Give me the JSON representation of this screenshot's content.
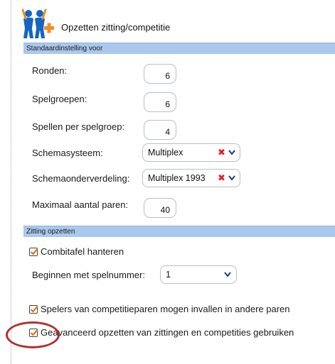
{
  "header": {
    "title": "Opzetten zitting/competitie",
    "logo_icon": "players-plus-logo"
  },
  "section_default": {
    "title": "Standaardinstelling voor",
    "rounds": {
      "label": "Ronden:",
      "value": "6"
    },
    "groups": {
      "label": "Spelgroepen:",
      "value": "6"
    },
    "games_per_group": {
      "label": "Spellen per spelgroep:",
      "value": "4"
    },
    "schema_system": {
      "label": "Schemasysteem:",
      "value": "Multiplex"
    },
    "schema_subdivision": {
      "label": "Schemaonderverdeling:",
      "value": "Multiplex 1993"
    },
    "max_pairs": {
      "label": "Maximaal aantal paren:",
      "value": "40"
    }
  },
  "section_session": {
    "title": "Zitting opzetten",
    "combitable": {
      "label": "Combitafel hanteren",
      "checked": true
    },
    "start_game": {
      "label": "Beginnen met spelnummer:",
      "value": "1"
    },
    "players_substitute": {
      "label": "Spelers van competitieparen mogen invallen in andere paren",
      "checked": true
    },
    "advanced_setup": {
      "label": "Geavanceerd opzetten van zittingen en competities gebruiken",
      "checked": true
    }
  },
  "colors": {
    "section_bar": "#aac8ec",
    "check_mark": "#e8731a",
    "clear_x": "#e0202a",
    "chevron": "#1f3a8a",
    "highlight": "#b03030"
  }
}
